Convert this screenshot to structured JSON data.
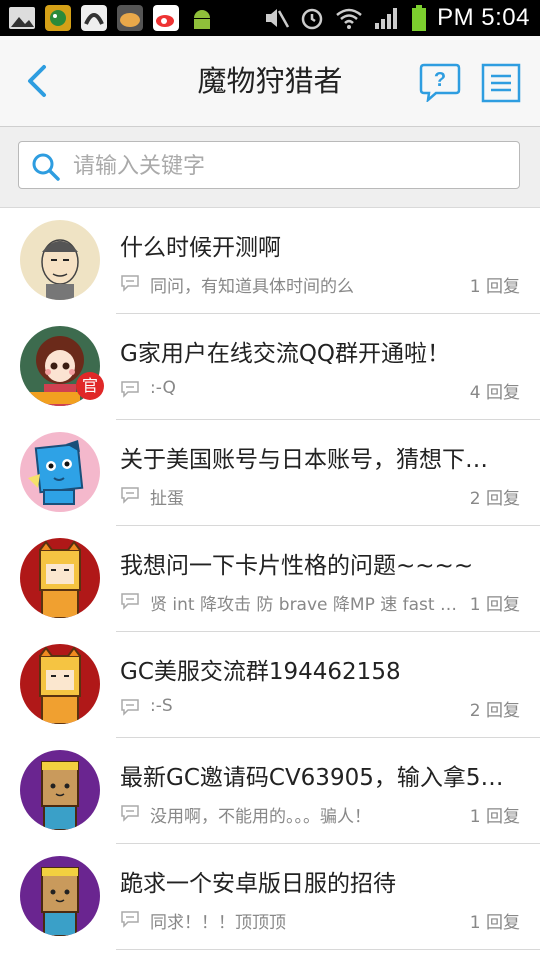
{
  "status_bar": {
    "time": "PM 5:04",
    "icons": [
      "gallery-icon",
      "game-icon",
      "music-icon",
      "app-icon",
      "weibo-icon",
      "android-icon",
      "mute-icon",
      "alarm-icon",
      "wifi-icon",
      "signal-icon",
      "battery-icon"
    ]
  },
  "header": {
    "title": "魔物狩猎者",
    "back_icon": "back-arrow-icon",
    "help_icon": "help-bubble-icon",
    "menu_icon": "menu-list-icon",
    "accent_color": "#2e9de0"
  },
  "search": {
    "placeholder": "请输入关键字",
    "value": ""
  },
  "posts": [
    {
      "title": "什么时候开测啊",
      "preview": "同问，有知道具体时间的么",
      "replies": "1 回复"
    },
    {
      "title": "G家用户在线交流QQ群开通啦！",
      "preview": ":-Q",
      "replies": "4 回复",
      "badge": "官"
    },
    {
      "title": "关于美国账号与日本账号，猜想下…",
      "preview": "扯蛋",
      "replies": "2 回复"
    },
    {
      "title": "我想问一下卡片性格的问题~~~~",
      "preview": "贤 int 降攻击 防 brave 降MP 速 fast …",
      "replies": "1 回复"
    },
    {
      "title": "GC美服交流群194462158",
      "preview": ":-S",
      "replies": "2 回复"
    },
    {
      "title": "最新GC邀请码CV63905，输入拿5…",
      "preview": "没用啊，不能用的。。。骗人！",
      "replies": "1 回复"
    },
    {
      "title": "跪求一个安卓版日服的招待",
      "preview": "同求！！！顶顶顶",
      "replies": "1 回复"
    }
  ]
}
